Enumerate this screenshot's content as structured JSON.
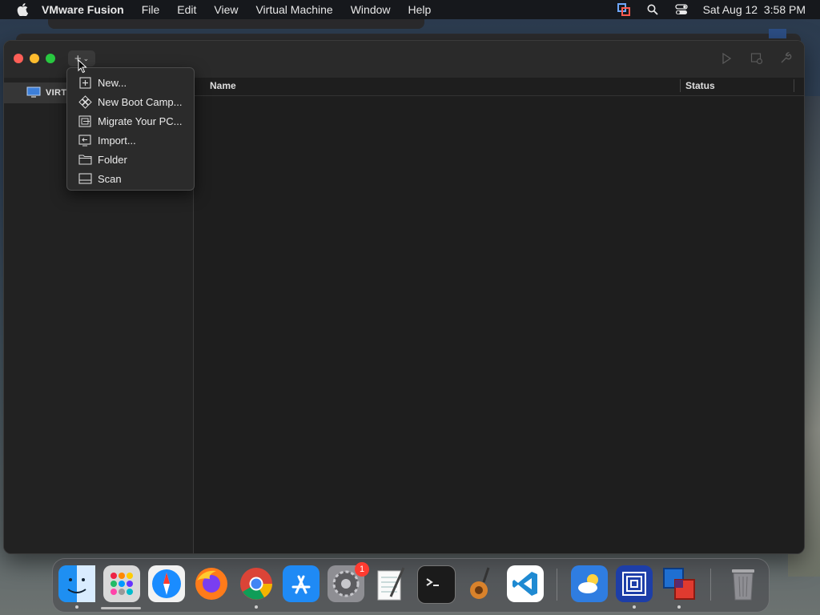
{
  "menubar": {
    "app_name": "VMware Fusion",
    "items": [
      "File",
      "Edit",
      "View",
      "Virtual Machine",
      "Window",
      "Help"
    ],
    "clock": "Sat Aug 12  3:58 PM"
  },
  "window": {
    "sidebar": {
      "items": [
        {
          "label": "VIRTUAL MACHINES",
          "icon": "monitor-icon"
        }
      ]
    },
    "columns": {
      "name": "Name",
      "status": "Status"
    },
    "add_menu": {
      "items": [
        {
          "label": "New...",
          "icon": "plus-box-icon"
        },
        {
          "label": "New Boot Camp...",
          "icon": "bootcamp-icon"
        },
        {
          "label": "Migrate Your PC...",
          "icon": "migrate-icon"
        },
        {
          "label": "Import...",
          "icon": "import-icon"
        },
        {
          "label": "Folder",
          "icon": "folder-icon"
        },
        {
          "label": "Scan",
          "icon": "scan-icon"
        }
      ]
    }
  },
  "dock": {
    "apps": [
      "Finder",
      "Launchpad",
      "Safari",
      "Firefox",
      "Chrome",
      "App Store",
      "System Settings",
      "TextEdit",
      "Terminal",
      "GarageBand",
      "Visual Studio Code",
      "Weather",
      "VMware Fusion Library",
      "VMware Fusion",
      "Trash"
    ],
    "settings_badge": "1"
  }
}
